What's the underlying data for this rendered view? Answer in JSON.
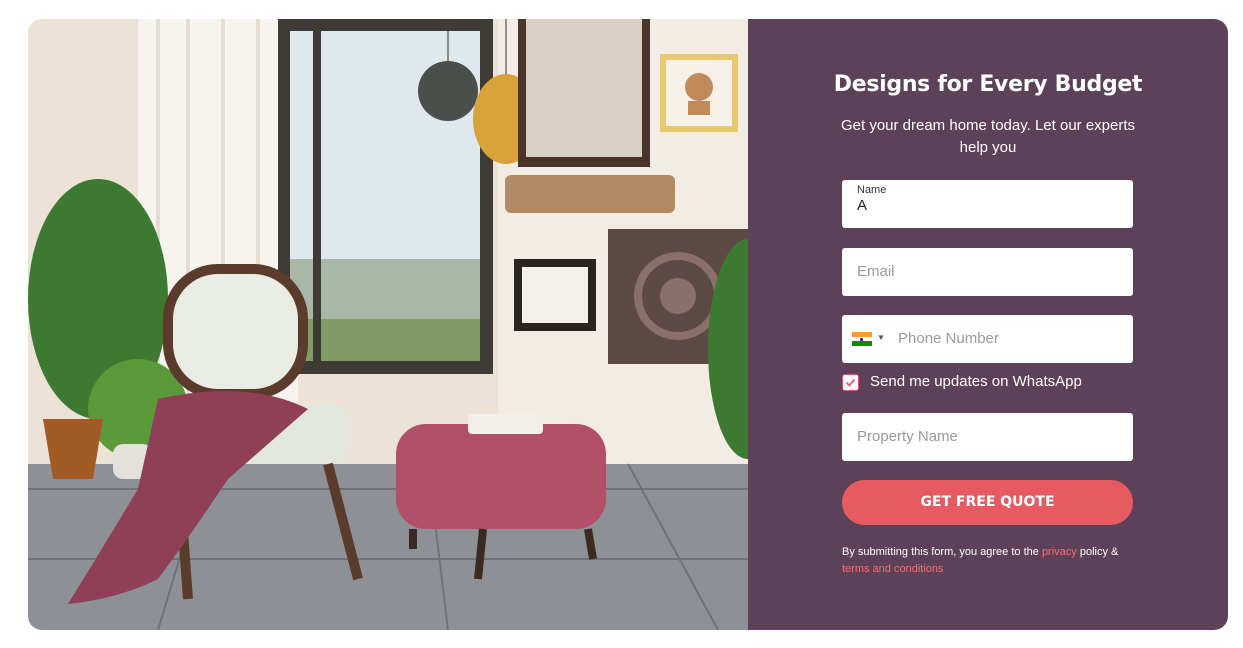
{
  "form": {
    "title": "Designs for Every Budget",
    "subtitle": "Get your dream home today. Let our experts help you",
    "name_label": "Name",
    "name_value": "A",
    "email_placeholder": "Email",
    "phone_placeholder": "Phone Number",
    "country_flag": "india-flag-icon",
    "whatsapp_label": "Send me updates on WhatsApp",
    "whatsapp_checked": true,
    "property_placeholder": "Property Name",
    "submit_label": "GET FREE QUOTE",
    "legal_prefix": "By submitting this form, you agree to the ",
    "privacy_link": "privacy",
    "legal_middle": " policy & ",
    "terms_link": "terms and conditions"
  },
  "colors": {
    "panel": "#5d4158",
    "accent": "#e85a62",
    "link": "#ff6a72"
  }
}
